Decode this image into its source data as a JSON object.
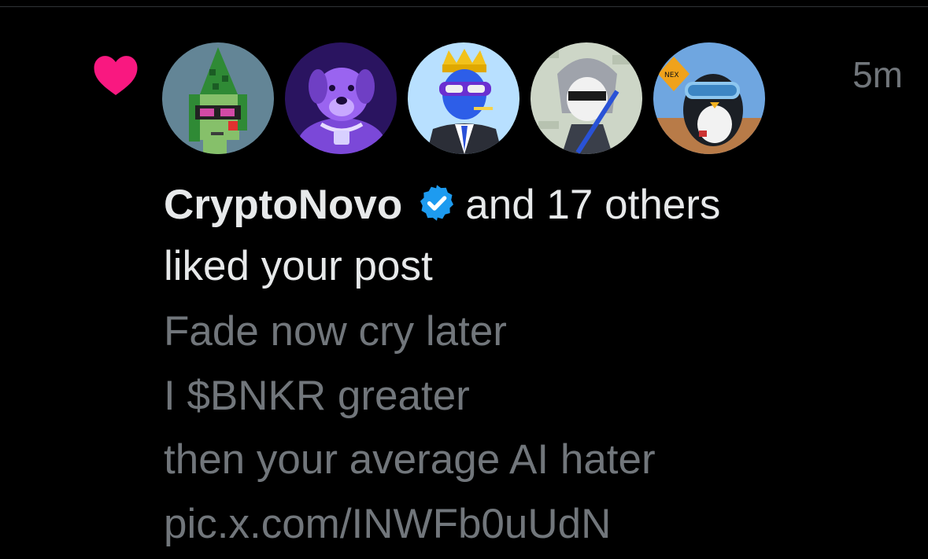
{
  "notification": {
    "type_icon": "heart-icon",
    "time": "5m",
    "avatars": [
      {
        "name": "CryptoNovo",
        "icon": "pixel-punk-avatar"
      },
      {
        "name": "",
        "icon": "purple-dog-avatar"
      },
      {
        "name": "",
        "icon": "crowned-blue-figure-avatar"
      },
      {
        "name": "",
        "icon": "anime-character-avatar"
      },
      {
        "name": "",
        "icon": "penguin-goggles-avatar"
      }
    ],
    "actor": "CryptoNovo",
    "others_text": "and 17 others",
    "action_text": "liked your post",
    "post_lines": [
      "Fade now cry later",
      "I $BNKR greater",
      "then your average AI hater",
      "pic.x.com/INWFb0uUdN"
    ]
  },
  "colors": {
    "background": "#000000",
    "primary_text": "#e7e9ea",
    "secondary_text": "#71767b",
    "like_pink": "#f91880",
    "verified_blue": "#1d9bf0"
  }
}
